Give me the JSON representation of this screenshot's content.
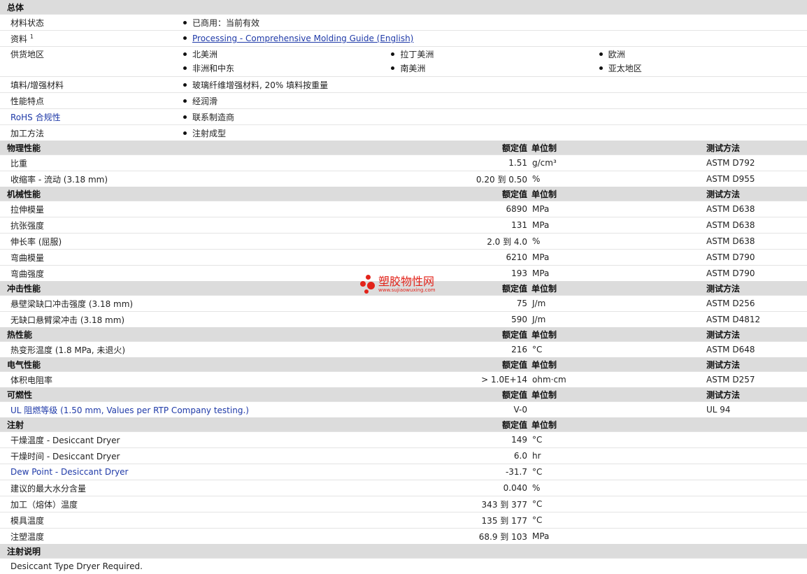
{
  "general": {
    "title": "总体",
    "material_status_label": "材料状态",
    "material_status_value": "已商用：当前有效",
    "docs_label": "资料",
    "docs_sup": "1",
    "docs_link": "Processing - Comprehensive Molding Guide (English)",
    "regions_label": "供货地区",
    "regions": [
      "北美洲",
      "拉丁美洲",
      "欧洲",
      "非洲和中东",
      "南美洲",
      "亚太地区"
    ],
    "filler_label": "填料/增强材料",
    "filler_value": "玻璃纤维增强材料, 20% 填料按重量",
    "features_label": "性能特点",
    "features_value": "经润滑",
    "rohs_label": "RoHS 合规性",
    "rohs_value": "联系制造商",
    "processing_label": "加工方法",
    "processing_value": "注射成型"
  },
  "columns": {
    "nominal": "额定值",
    "unit": "单位制",
    "method": "测试方法"
  },
  "physical": {
    "title": "物理性能",
    "rows": [
      {
        "label": "比重",
        "value": "1.51",
        "unit": "g/cm³",
        "method": "ASTM D792"
      },
      {
        "label": "收缩率  - 流动  (3.18 mm)",
        "value": "0.20 到  0.50",
        "unit": "%",
        "method": "ASTM D955"
      }
    ]
  },
  "mechanical": {
    "title": "机械性能",
    "rows": [
      {
        "label": "拉伸模量",
        "value": "6890",
        "unit": "MPa",
        "method": "ASTM D638"
      },
      {
        "label": "抗张强度",
        "value": "131",
        "unit": "MPa",
        "method": "ASTM D638"
      },
      {
        "label": "伸长率  (屈服)",
        "value": "2.0 到  4.0",
        "unit": "%",
        "method": "ASTM D638"
      },
      {
        "label": "弯曲模量",
        "value": "6210",
        "unit": "MPa",
        "method": "ASTM D790"
      },
      {
        "label": "弯曲强度",
        "value": "193",
        "unit": "MPa",
        "method": "ASTM D790"
      }
    ]
  },
  "impact": {
    "title": "冲击性能",
    "rows": [
      {
        "label": "悬壁梁缺口冲击强度  (3.18 mm)",
        "value": "75",
        "unit": "J/m",
        "method": "ASTM D256"
      },
      {
        "label": "无缺口悬臂梁冲击  (3.18 mm)",
        "value": "590",
        "unit": "J/m",
        "method": "ASTM D4812"
      }
    ]
  },
  "thermal": {
    "title": "热性能",
    "rows": [
      {
        "label": "热变形温度  (1.8 MPa, 未退火)",
        "value": "216",
        "unit": "°C",
        "method": "ASTM D648"
      }
    ]
  },
  "electrical": {
    "title": "电气性能",
    "rows": [
      {
        "label": "体积电阻率",
        "value": "> 1.0E+14",
        "unit": "ohm·cm",
        "method": "ASTM D257"
      }
    ]
  },
  "flammability": {
    "title": "可燃性",
    "rows": [
      {
        "label": "UL 阻燃等级  (1.50 mm, Values per RTP Company testing.)",
        "value": "V-0",
        "unit": "",
        "method": "UL 94"
      }
    ]
  },
  "injection": {
    "title": "注射",
    "rows": [
      {
        "label": "干燥温度  - Desiccant Dryer",
        "value": "149",
        "unit": "°C"
      },
      {
        "label": "干燥时间  - Desiccant Dryer",
        "value": "6.0",
        "unit": "hr"
      },
      {
        "label": "Dew Point - Desiccant Dryer",
        "value": "-31.7",
        "unit": "°C"
      },
      {
        "label": "建议的最大水分含量",
        "value": "0.040",
        "unit": "%"
      },
      {
        "label": "加工（熔体）温度",
        "value": "343 到  377",
        "unit": "°C"
      },
      {
        "label": "模具温度",
        "value": "135 到  177",
        "unit": "°C"
      },
      {
        "label": "注塑温度",
        "value": "68.9 到  103",
        "unit": "MPa"
      }
    ]
  },
  "injection_notes": {
    "title": "注射说明",
    "text": "Desiccant Type Dryer Required."
  },
  "watermark": {
    "name": "塑胶物性网",
    "url": "www.sujiaowuxing.com"
  }
}
